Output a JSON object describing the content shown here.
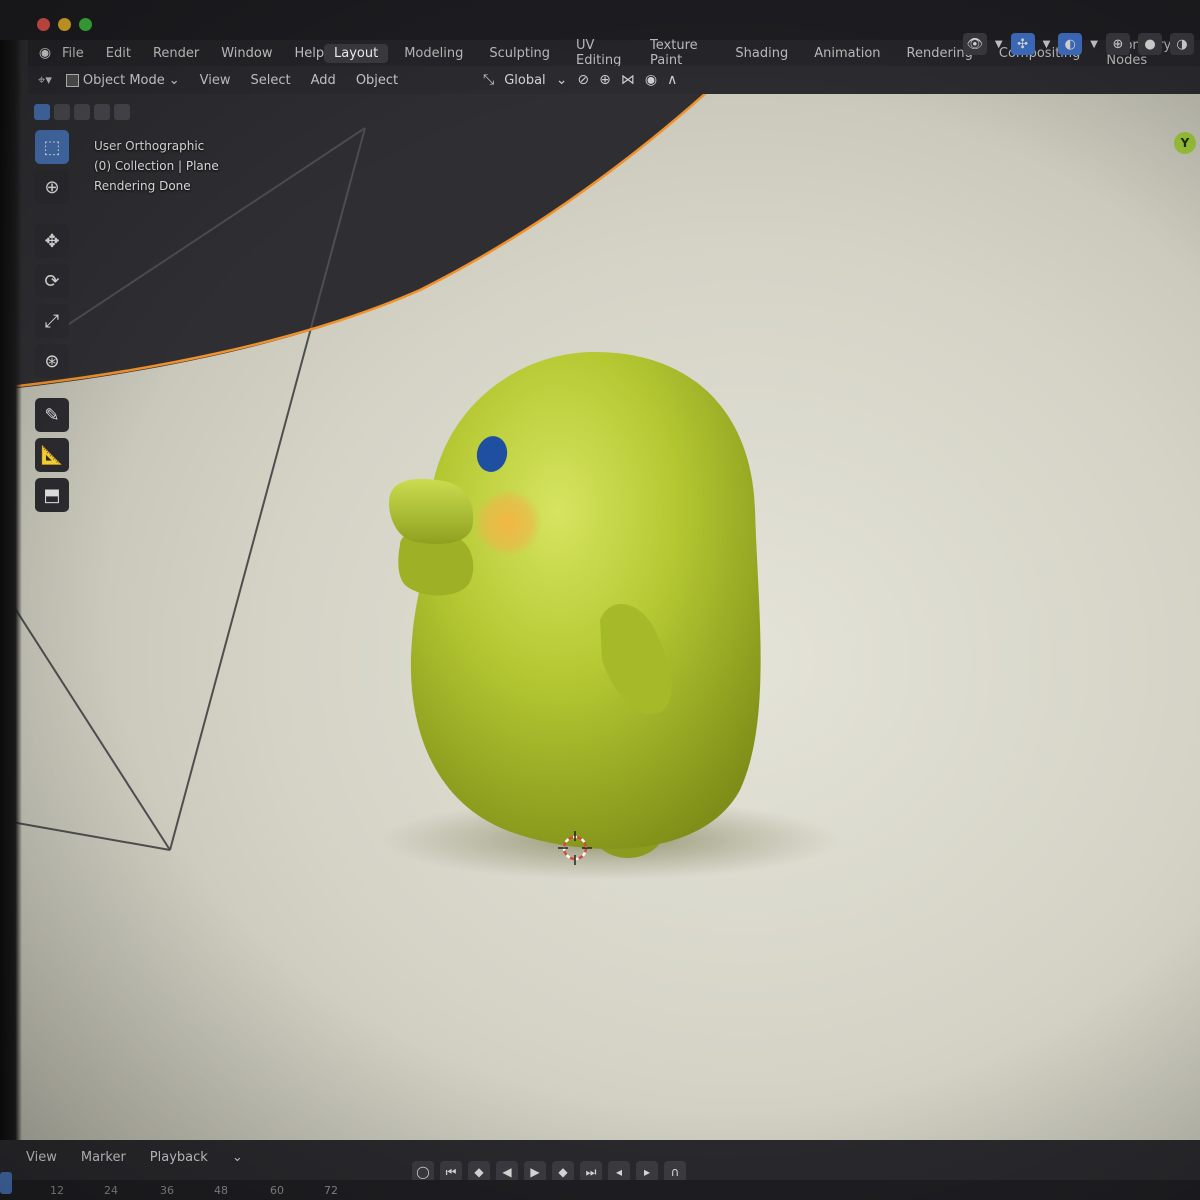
{
  "menubar": {
    "items": [
      "File",
      "Edit",
      "Render",
      "Window",
      "Help"
    ]
  },
  "workspaces": {
    "tabs": [
      "Layout",
      "Modeling",
      "Sculpting",
      "UV Editing",
      "Texture Paint",
      "Shading",
      "Animation",
      "Rendering",
      "Compositing",
      "Geometry Nodes"
    ],
    "active": "Layout"
  },
  "header": {
    "mode": "Object Mode",
    "menus": [
      "View",
      "Select",
      "Add",
      "Object"
    ],
    "transform_orientation": "Global"
  },
  "viewport": {
    "view_name": "User Orthographic",
    "collection": "(0) Collection | Plane",
    "status": "Rendering Done",
    "gizmo_axis": "Y"
  },
  "timeline": {
    "menus": [
      "View",
      "Marker",
      "Playback"
    ],
    "frames": [
      "12",
      "24",
      "36",
      "48",
      "60",
      "72"
    ]
  },
  "colors": {
    "accent_blue": "#4772b3",
    "selection_orange": "#f0912b",
    "axis_y_green": "#9ac43a",
    "character_green": "#b5c832"
  }
}
